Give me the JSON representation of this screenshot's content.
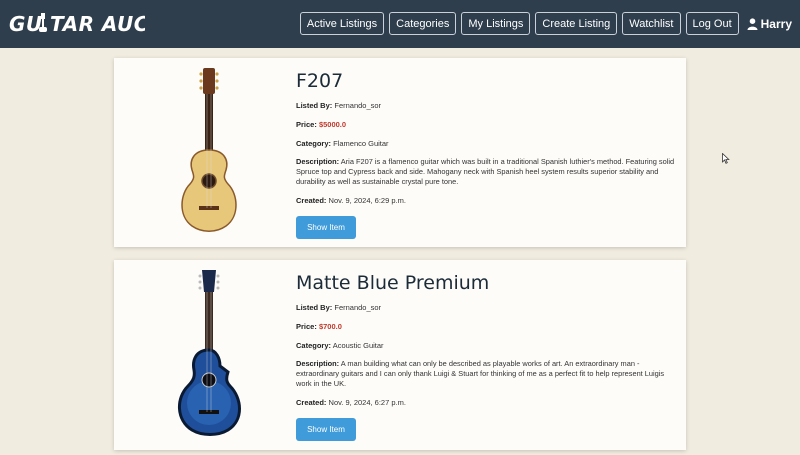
{
  "brand": {
    "name": "GUITAR AUCTIONS"
  },
  "nav": {
    "items": [
      {
        "label": "Active Listings"
      },
      {
        "label": "Categories"
      },
      {
        "label": "My Listings"
      },
      {
        "label": "Create Listing"
      },
      {
        "label": "Watchlist"
      },
      {
        "label": "Log Out"
      }
    ],
    "user": "Harry"
  },
  "labels": {
    "listed_by": "Listed By:",
    "price": "Price:",
    "category": "Category:",
    "description": "Description:",
    "created": "Created:",
    "show_item": "Show Item"
  },
  "listings": [
    {
      "title": "F207",
      "listed_by": "Fernando_sor",
      "price": "$5000.0",
      "category": "Flamenco Guitar",
      "description": "Aria F207 is a flamenco guitar which was built in a traditional Spanish luthier's method. Featuring solid Spruce top and Cypress back and side. Mahogany neck with Spanish heel system results superior stability and durability as well as sustainable crystal pure tone.",
      "created": "Nov. 9, 2024, 6:29 p.m.",
      "image": "classical-guitar"
    },
    {
      "title": "Matte Blue Premium",
      "listed_by": "Fernando_sor",
      "price": "$700.0",
      "category": "Acoustic Guitar",
      "description": "A man building what can only be described as playable works of art. An extraordinary man - extraordinary guitars and I can only thank Luigi & Stuart for thinking of me as a perfect fit to help represent Luigis work in the UK.",
      "created": "Nov. 9, 2024, 6:27 p.m.",
      "image": "blue-acoustic-guitar"
    }
  ],
  "colors": {
    "navbar": "#2e3e4d",
    "background": "#f1ece0",
    "price": "#c0392b",
    "button": "#3f9bd9"
  }
}
